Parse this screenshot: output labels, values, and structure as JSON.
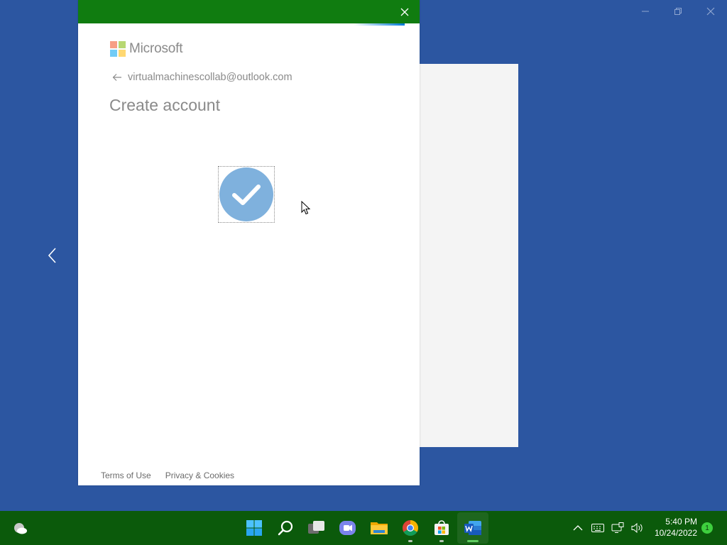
{
  "dialog": {
    "brand": "Microsoft",
    "identity_email": "virtualmachinescollab@outlook.com",
    "heading": "Create account",
    "footer": {
      "terms": "Terms of Use",
      "privacy": "Privacy & Cookies"
    }
  },
  "taskbar": {
    "apps": [
      "start-icon",
      "search-icon",
      "task-view-icon",
      "chat-icon",
      "file-explorer-icon",
      "chrome-icon",
      "microsoft-store-icon",
      "word-icon"
    ],
    "clock": {
      "time": "5:40 PM",
      "date": "10/24/2022"
    },
    "notification_count": "1"
  },
  "colors": {
    "accent": "#107c10",
    "desktop": "#2c56a1",
    "taskbar": "#0b5a0b",
    "check": "#7fb1dd"
  }
}
